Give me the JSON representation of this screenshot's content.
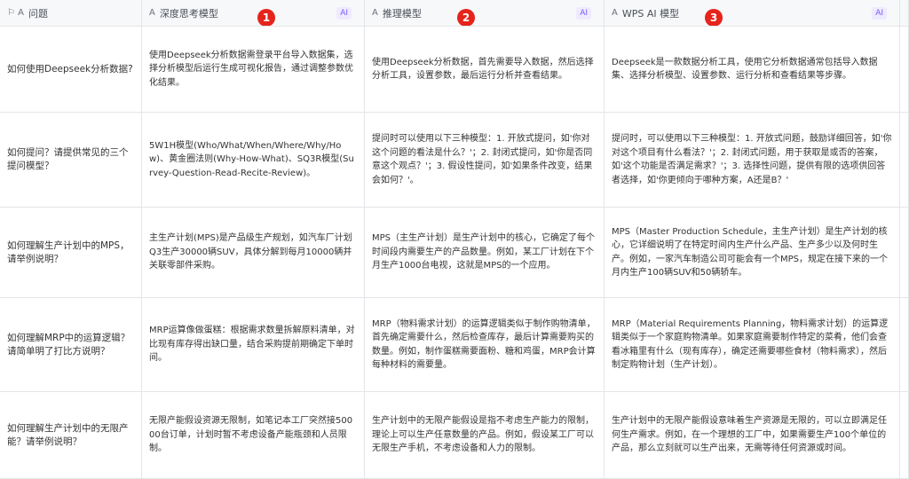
{
  "header": {
    "question": {
      "icon": "⚐ A",
      "label": "问题"
    },
    "deep_model": {
      "icon": "A",
      "label": "深度思考模型",
      "ai": "AI",
      "badge": "1"
    },
    "reason_model": {
      "icon": "A",
      "label": "推理模型",
      "ai": "AI",
      "badge": "2"
    },
    "wps_model": {
      "icon": "A",
      "label": "WPS AI 模型",
      "ai": "AI",
      "badge": "3"
    }
  },
  "rows": [
    {
      "question": "如何使用Deepseek分析数据?",
      "deep": "使用Deepseek分析数据需登录平台导入数据集，选择分析模型后运行生成可视化报告，通过调整参数优化结果。",
      "reason": "使用Deepseek分析数据，首先需要导入数据，然后选择分析工具，设置参数，最后运行分析并查看结果。",
      "wps": "Deepseek是一款数据分析工具，使用它分析数据通常包括导入数据集、选择分析模型、设置参数、运行分析和查看结果等步骤。"
    },
    {
      "question": "如何提问？请提供常见的三个提问模型？",
      "deep": "5W1H模型(Who/What/When/Where/Why/How)、黄金圈法则(Why-How-What)、SQ3R模型(Survey-Question-Read-Recite-Review)。",
      "reason": "提问时可以使用以下三种模型：1. 开放式提问，如'你对这个问题的看法是什么？'；2. 封闭式提问，如'你是否同意这个观点？'；3. 假设性提问，如'如果条件改变，结果会如何？'。",
      "wps": "提问时，可以使用以下三种模型：1. 开放式问题，鼓励详细回答，如'你对这个项目有什么看法？'；2. 封闭式问题，用于获取是或否的答案，如'这个功能是否满足需求？'；3. 选择性问题，提供有限的选项供回答者选择，如'你更倾向于哪种方案，A还是B？'"
    },
    {
      "question": "如何理解生产计划中的MPS，请举例说明？",
      "deep": "主生产计划(MPS)是产品级生产规划，如汽车厂计划Q3生产30000辆SUV，具体分解到每月10000辆并关联零部件采购。",
      "reason": "MPS（主生产计划）是生产计划中的核心，它确定了每个时间段内需要生产的产品数量。例如，某工厂计划在下个月生产1000台电视，这就是MPS的一个应用。",
      "wps": "MPS（Master Production Schedule，主生产计划）是生产计划的核心，它详细说明了在特定时间内生产什么产品、生产多少以及何时生产。例如，一家汽车制造公司可能会有一个MPS，规定在接下来的一个月内生产100辆SUV和50辆轿车。"
    },
    {
      "question": "如何理解MRP中的运算逻辑？请简单明了打比方说明？",
      "deep": "MRP运算像做蛋糕：根据需求数量拆解原料清单，对比现有库存得出缺口量，结合采购提前期确定下单时间。",
      "reason": "MRP（物料需求计划）的运算逻辑类似于制作购物清单，首先确定需要什么，然后检查库存，最后计算需要购买的数量。例如，制作蛋糕需要面粉、糖和鸡蛋，MRP会计算每种材料的需要量。",
      "wps": "MRP（Material Requirements Planning，物料需求计划）的运算逻辑类似于一个家庭购物清单。如果家庭需要制作特定的菜肴，他们会查看冰箱里有什么（现有库存），确定还需要哪些食材（物料需求），然后制定购物计划（生产计划）。"
    },
    {
      "question": "如何理解生产计划中的无限产能？请举例说明？",
      "deep": "无限产能假设资源无限制，如笔记本工厂突然接50000台订单，计划时暂不考虑设备产能瓶颈和人员限制。",
      "reason": "生产计划中的无限产能假设是指不考虑生产能力的限制，理论上可以生产任意数量的产品。例如，假设某工厂可以无限生产手机，不考虑设备和人力的限制。",
      "wps": "生产计划中的无限产能假设意味着生产资源是无限的，可以立即满足任何生产需求。例如，在一个理想的工厂中，如果需要生产100个单位的产品，那么立刻就可以生产出来，无需等待任何资源或时间。"
    }
  ]
}
